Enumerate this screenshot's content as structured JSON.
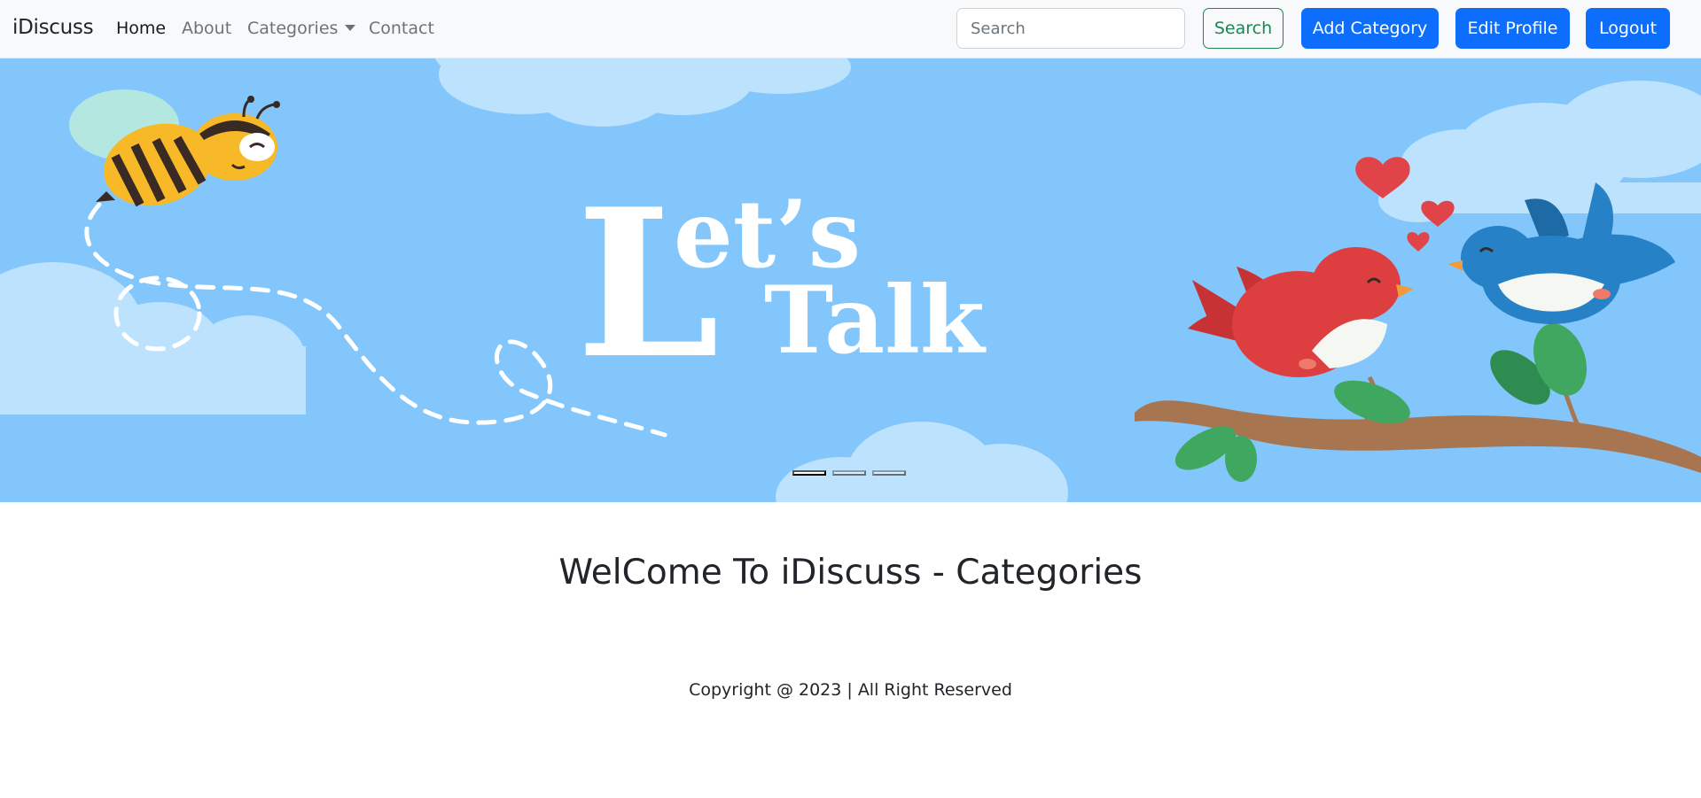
{
  "navbar": {
    "brand": "iDiscuss",
    "links": [
      {
        "label": "Home"
      },
      {
        "label": "About"
      },
      {
        "label": "Categories"
      },
      {
        "label": "Contact"
      }
    ],
    "search": {
      "placeholder": "Search",
      "value": ""
    },
    "search_button": "Search",
    "add_category_button": "Add Category",
    "edit_profile_button": "Edit Profile",
    "logout_button": "Logout"
  },
  "hero": {
    "banner_text_line1": "Let’s",
    "banner_text_line2": "Talk",
    "slides_count": 3,
    "active_slide": 1,
    "colors": {
      "sky": "#82c6fb",
      "cloud": "#bde2fd",
      "bee_yellow": "#f7b928",
      "bird_red": "#dd3f41",
      "bird_blue": "#2781c6",
      "branch": "#a87551",
      "leaf": "#3fa760",
      "heart": "#e04449"
    }
  },
  "main": {
    "heading": "WelCome To iDiscuss - Categories"
  },
  "footer": {
    "text": "Copyright @ 2023 | All Right Reserved"
  }
}
